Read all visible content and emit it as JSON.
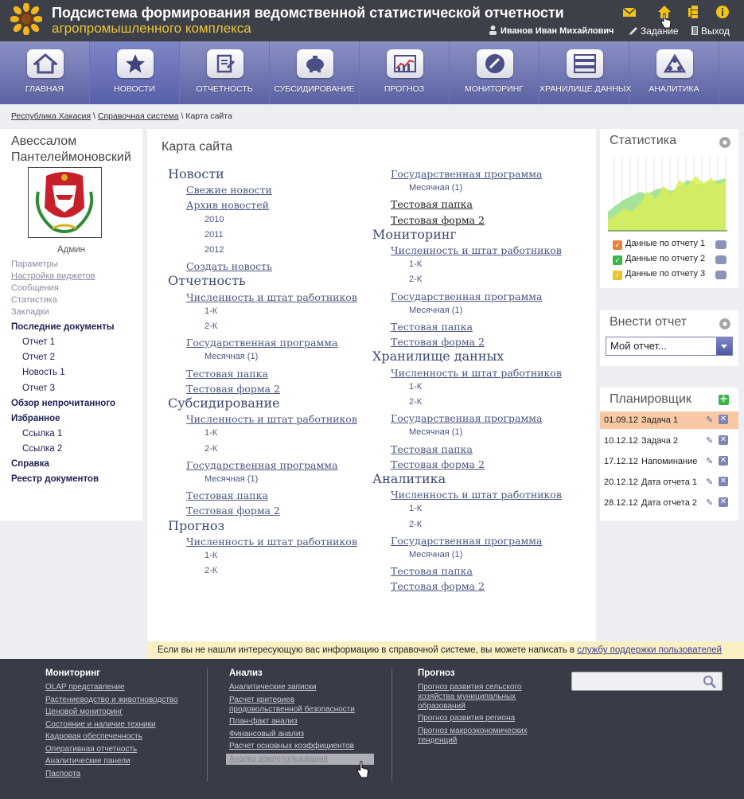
{
  "header": {
    "title_line1": "Подсистема формирования ведомственной статистической отчетности",
    "title_line2": "агропромышленного комплекса",
    "user": "Иванов Иван Михайлович",
    "task_label": "Задание",
    "exit_label": "Выход",
    "icons": [
      "mail-icon",
      "home-icon",
      "network-icon",
      "info-icon"
    ]
  },
  "nav": [
    {
      "label": "ГЛАВНАЯ",
      "icon": "house-icon"
    },
    {
      "label": "НОВОСТИ",
      "icon": "star-icon"
    },
    {
      "label": "ОТЧЕТНОСТЬ",
      "icon": "report-icon"
    },
    {
      "label": "СУБСИДИРОВАНИЕ",
      "icon": "piggy-bank-icon"
    },
    {
      "label": "ПРОГНОЗ",
      "icon": "forecast-chart-icon"
    },
    {
      "label": "МОНИТОРИНГ",
      "icon": "monitoring-gauge-icon"
    },
    {
      "label": "ХРАНИЛИЩЕ ДАННЫХ",
      "icon": "database-icon"
    },
    {
      "label": "АНАЛИТИКА",
      "icon": "analytics-icon"
    }
  ],
  "breadcrumb": {
    "item1": "Республика Хакасия",
    "item2": "Справочная система",
    "current": "Карта сайта",
    "sep": "\\"
  },
  "left": {
    "name": "Авессалом Пантелеймоновский",
    "role": "Админ",
    "menu_top": [
      "Параметры",
      "Настройка виджетов",
      "Сообщения",
      "Статистика",
      "Закладки"
    ],
    "recent_title": "Последние документы",
    "recent": [
      "Отчет 1",
      "Отчет 2",
      "Новость 1",
      "Отчет 3"
    ],
    "unread": "Обзор непрочитанного",
    "fav_title": "Избранное",
    "favs": [
      "Ссылка 1",
      "Ссылка 2"
    ],
    "help": "Справка",
    "registry": "Реестр документов"
  },
  "main": {
    "title": "Карта сайта",
    "col1": [
      {
        "t": "Новости",
        "l": 1
      },
      {
        "t": "Свежие новости",
        "l": 2
      },
      {
        "t": "Архив новостей",
        "l": 2
      },
      {
        "t": "2010",
        "l": 3
      },
      {
        "t": "2011",
        "l": 3
      },
      {
        "t": "2012",
        "l": 3
      },
      {
        "t": "Создать новость",
        "l": 2
      },
      {
        "t": "Отчетность",
        "l": 1
      },
      {
        "t": "Численность и штат работников",
        "l": 2
      },
      {
        "t": "1-К",
        "l": 3
      },
      {
        "t": "2-К",
        "l": 3
      },
      {
        "t": "Государственная программа",
        "l": 2
      },
      {
        "t": "Месячная (1)",
        "l": 3
      },
      {
        "t": "Тестовая папка",
        "l": 2
      },
      {
        "t": "Тестовая форма 2",
        "l": 2
      },
      {
        "t": "Субсидирование",
        "l": 1
      },
      {
        "t": "Численность и штат работников",
        "l": 2
      },
      {
        "t": "1-К",
        "l": 3
      },
      {
        "t": "2-К",
        "l": 3
      },
      {
        "t": "Государственная программа",
        "l": 2
      },
      {
        "t": "Месячная (1)",
        "l": 3
      },
      {
        "t": "Тестовая папка",
        "l": 2
      },
      {
        "t": "Тестовая форма 2",
        "l": 2
      },
      {
        "t": "Прогноз",
        "l": 1
      },
      {
        "t": "Численность и штат работников",
        "l": 2
      },
      {
        "t": "1-К",
        "l": 3
      },
      {
        "t": "2-К",
        "l": 3
      }
    ],
    "col2": [
      {
        "t": "Государственная программа",
        "l": 2
      },
      {
        "t": "Месячная (1)",
        "l": 3
      },
      {
        "t": "Тестовая папка",
        "l": 2,
        "dark": true
      },
      {
        "t": "Тестовая форма 2",
        "l": 2,
        "dark": true
      },
      {
        "t": "Мониторинг",
        "l": 1
      },
      {
        "t": "Численность и штат работников",
        "l": 2
      },
      {
        "t": "1-К",
        "l": 3
      },
      {
        "t": "2-К",
        "l": 3
      },
      {
        "t": "Государственная программа",
        "l": 2
      },
      {
        "t": "Месячная (1)",
        "l": 3
      },
      {
        "t": "Тестовая папка",
        "l": 2
      },
      {
        "t": "Тестовая форма 2",
        "l": 2
      },
      {
        "t": "Хранилище данных",
        "l": 1
      },
      {
        "t": "Численность и штат работников",
        "l": 2
      },
      {
        "t": "1-К",
        "l": 3
      },
      {
        "t": "2-К",
        "l": 3
      },
      {
        "t": "Государственная программа",
        "l": 2
      },
      {
        "t": "Месячная (1)",
        "l": 3
      },
      {
        "t": "Тестовая папка",
        "l": 2
      },
      {
        "t": "Тестовая форма 2",
        "l": 2
      },
      {
        "t": "Аналитика",
        "l": 1
      },
      {
        "t": "Численность и штат работников",
        "l": 2
      },
      {
        "t": "1-К",
        "l": 3
      },
      {
        "t": "2-К",
        "l": 3
      },
      {
        "t": "Государственная программа",
        "l": 2
      },
      {
        "t": "Месячная (1)",
        "l": 3
      },
      {
        "t": "Тестовая папка",
        "l": 2
      },
      {
        "t": "Тестовая форма 2",
        "l": 2
      }
    ]
  },
  "info": {
    "text": "Если вы не нашли интересующую вас информацию в справочной системе, вы можете написать в ",
    "link": "службу поддержки пользователей"
  },
  "stats": {
    "title": "Статистика",
    "legend": [
      {
        "label": "Данные по отчету 1",
        "color": "#e8823a"
      },
      {
        "label": "Данные по отчету 2",
        "color": "#3bb54a"
      },
      {
        "label": "Данные по отчету 3",
        "color": "#e9c32a"
      }
    ]
  },
  "report": {
    "title": "Внести отчет",
    "selected": "Мой отчет..."
  },
  "planner": {
    "title": "Планировщик",
    "rows": [
      {
        "date": "01.09.12",
        "name": "Задача 1"
      },
      {
        "date": "10.12.12",
        "name": "Задача 2"
      },
      {
        "date": "17.12.12",
        "name": "Напоминание"
      },
      {
        "date": "20.12.12",
        "name": "Дата отчета 1"
      },
      {
        "date": "28.12.12",
        "name": "Дата отчета 2"
      }
    ]
  },
  "footer": {
    "col1": {
      "title": "Мониторинг",
      "links": [
        "OLAP представление",
        "Растениеводство и животноводство",
        "Ценовой мониторинг",
        "Состояние и наличие техники",
        "Кадровая обеспеченность",
        "Оперативная отчетность",
        "Аналитические панели",
        "Паспорта"
      ]
    },
    "col2": {
      "title": "Анализ",
      "links": [
        "Аналитические записки",
        "Расчет критериев продовольственной безопасности",
        "План-факт анализ",
        "Финансовый анализ",
        "Расчет основных коэффициентов",
        "Анализ землепользования"
      ]
    },
    "col3": {
      "title": "Прогноз",
      "links": [
        "Прогноз развития сельского хозяйства муниципальных образований",
        "Прогноз развития региона",
        "Прогноз макроэкономических тенденций"
      ]
    }
  }
}
